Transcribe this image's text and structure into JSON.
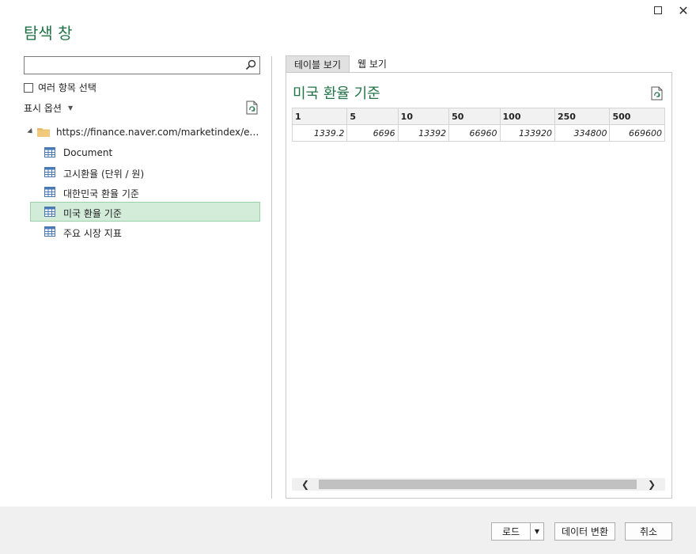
{
  "window": {
    "title": "탐색 창",
    "max_icon": "maximize-icon",
    "close_label": "✕"
  },
  "left": {
    "search": {
      "value": "",
      "placeholder": "",
      "icon": "search-icon"
    },
    "multi_select_label": "여러 항목 선택",
    "display_options_label": "표시 옵션",
    "display_options_caret": "▼",
    "tree": {
      "root_label": "https://finance.naver.com/marketindex/exchan...",
      "items": [
        {
          "label": "Document",
          "selected": false
        },
        {
          "label": "고시환율 (단위 / 원)",
          "selected": false
        },
        {
          "label": "대한민국 환율 기준",
          "selected": false
        },
        {
          "label": "미국 환율 기준",
          "selected": true
        },
        {
          "label": "주요 시장 지표",
          "selected": false
        }
      ]
    }
  },
  "right": {
    "tabs": [
      {
        "label": "테이블 보기",
        "active": true
      },
      {
        "label": "웹 보기",
        "active": false
      }
    ],
    "preview_title": "미국 환율 기준",
    "table": {
      "headers": [
        "1",
        "5",
        "10",
        "50",
        "100",
        "250",
        "500"
      ],
      "rows": [
        [
          "1339.2",
          "6696",
          "13392",
          "66960",
          "133920",
          "334800",
          "669600"
        ]
      ]
    },
    "scrollbar": {
      "left_arrow": "❮",
      "right_arrow": "❯"
    }
  },
  "footer": {
    "load_label": "로드",
    "load_dropdown": "▼",
    "transform_label": "데이터 변환",
    "cancel_label": "취소"
  },
  "colors": {
    "accent": "#217346",
    "selected_bg": "#d3ecd9",
    "footer_bg": "#f0f0f0"
  }
}
